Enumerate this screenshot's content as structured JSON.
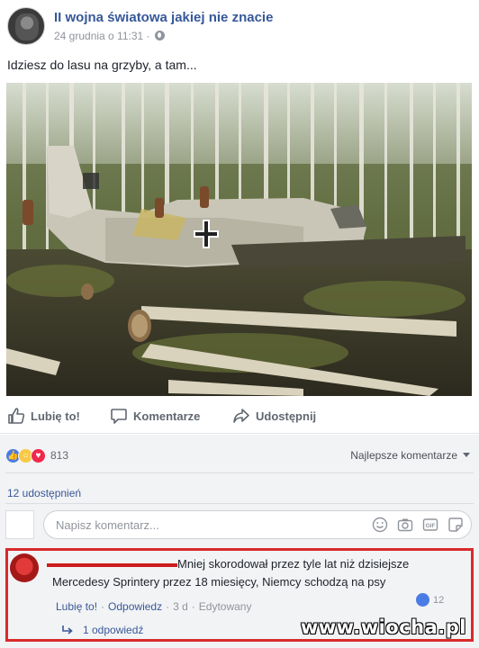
{
  "header": {
    "page_name": "II wojna światowa jakiej nie znacie",
    "date": "24 grudnia o 11:31",
    "separator": "·",
    "privacy_icon": "globe-icon"
  },
  "post": {
    "text": "Idziesz do lasu na grzyby, a tam...",
    "photo_icon": "plane-wreck-photo",
    "colors": {
      "forest": "#4a4f3a",
      "wreck": "#c9c6b8"
    }
  },
  "actions": {
    "like": "Lubię to!",
    "comment": "Komentarze",
    "share": "Udostępnij"
  },
  "feedback": {
    "reaction_count": "813",
    "sort_label": "Najlepsze komentarze",
    "shares": "12 udostępnień",
    "composer_placeholder": "Napisz komentarz..."
  },
  "comment": {
    "text_line1": "Mniej skorodował przez tyle lat niż dzisiejsze",
    "text_line2": "Mercedesy Sprintery przez 18 miesięcy, Niemcy schodzą na psy",
    "reaction_count": "12",
    "like": "Lubię to!",
    "reply": "Odpowiedz",
    "age": "3 d",
    "edited": "Edytowany",
    "separator": "·",
    "replies_label": "1 odpowiedź",
    "highlight_color": "#d92a2a"
  },
  "watermark": "www.wiocha.pl"
}
